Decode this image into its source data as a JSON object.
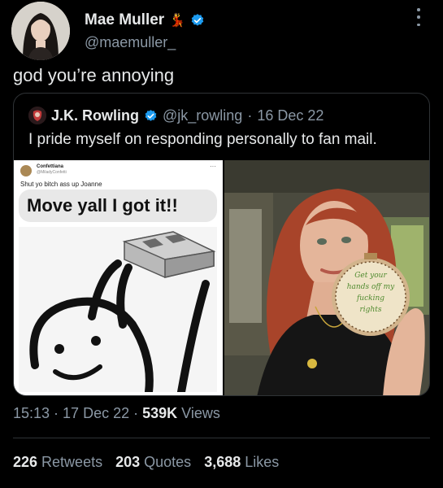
{
  "tweet": {
    "author": {
      "name": "Mae Muller",
      "emoji": "💃",
      "handle": "@maemuller_"
    },
    "text": "god you’re annoying",
    "time": "15:13",
    "date": "17 Dec 22",
    "views_count": "539K",
    "views_label": "Views",
    "sep": "·",
    "stats": {
      "retweets_count": "226",
      "retweets_label": "Retweets",
      "quotes_count": "203",
      "quotes_label": "Quotes",
      "likes_count": "3,688",
      "likes_label": "Likes"
    }
  },
  "quote": {
    "author": {
      "name": "J.K. Rowling",
      "handle": "@jk_rowling",
      "date": "16 Dec 22",
      "sep": "·"
    },
    "text": "I pride myself on responding personally to fan mail.",
    "meme": {
      "name": "Confettiana",
      "handle": "@MiladyConfetti",
      "dots": "···",
      "line": "Shut yo bitch ass up Joanne",
      "bubble": "Move yall I got it!!"
    },
    "photo": {
      "hoop_text": [
        "Get your",
        "hands off my",
        "fucking",
        "rights"
      ]
    }
  },
  "colors": {
    "background": "#000000",
    "text": "#e7e9ea",
    "muted": "#8b98a5",
    "verified": "#1d9bf0",
    "border": "#2f3336"
  }
}
